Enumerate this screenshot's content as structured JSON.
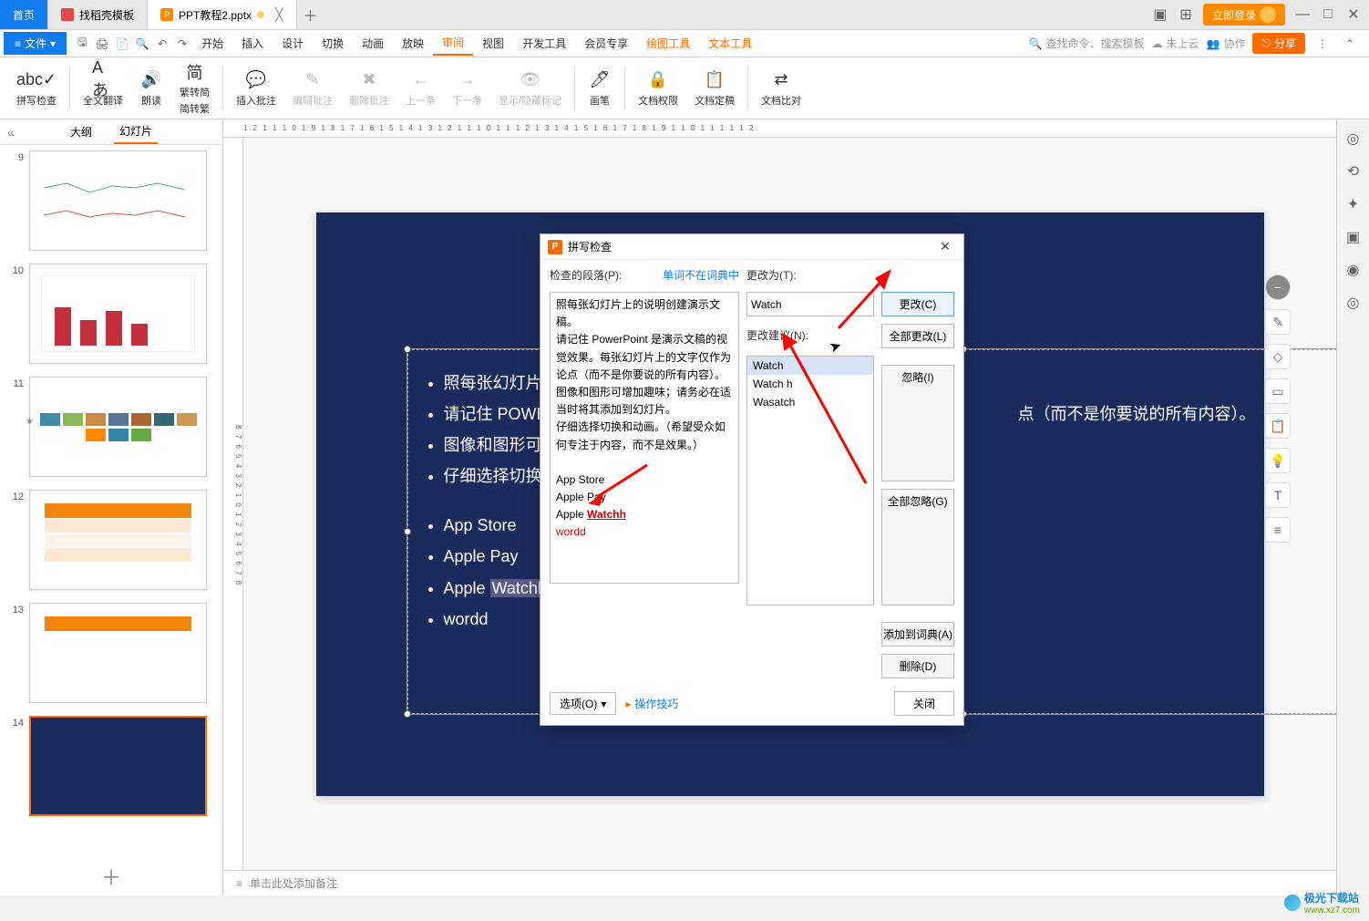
{
  "tabs": {
    "home": "首页",
    "template": "找稻壳模板",
    "doc": "PPT教程2.pptx"
  },
  "titlebarRight": {
    "login": "立即登录"
  },
  "fileMenu": "文件",
  "menu": {
    "start": "开始",
    "insert": "插入",
    "design": "设计",
    "transition": "切换",
    "anim": "动画",
    "show": "放映",
    "review": "审阅",
    "view": "视图",
    "dev": "开发工具",
    "member": "会员专享",
    "drawTool": "绘图工具",
    "textTool": "文本工具"
  },
  "menuRight": {
    "searchCmd": "查找命令、搜索模板",
    "cloud": "未上云",
    "coop": "协作",
    "share": "分享"
  },
  "ribbon": {
    "spell": "拼写检查",
    "translate": "全文翻译",
    "read": "朗读",
    "simpTrad": "繁转简",
    "simpTrad2": "简转繁",
    "insertComment": "插入批注",
    "editComment": "编辑批注",
    "deleteComment": "删除批注",
    "prev": "上一条",
    "next": "下一条",
    "showHide": "显示/隐藏标记",
    "ink": "画笔",
    "perm": "文档权限",
    "finalize": "文档定稿",
    "compare": "文档比对"
  },
  "panelTabs": {
    "outline": "大纲",
    "slides": "幻灯片"
  },
  "thumbNums": [
    "9",
    "10",
    "11",
    "12",
    "13",
    "14"
  ],
  "slideText": {
    "b1": "照每张幻灯片上的",
    "b2": "请记住 POWERP",
    "b2tail": "点（而不是你要说的所有内容）。",
    "b3": "图像和图形可增加",
    "b4": "仔细选择切换和动",
    "b5": "App Store",
    "b6": "Apple Pay",
    "b7a": "Apple ",
    "b7b": "Watchh",
    "b8": "wordd"
  },
  "dialog": {
    "title": "拼写检查",
    "paraLabel": "检查的段落(P):",
    "notInDict": "单词不在词典中",
    "changeToLabel": "更改为(T):",
    "changeToValue": "Watch",
    "suggestLabel": "更改建议(N):",
    "suggestions": [
      "Watch",
      "Watch h",
      "Wasatch"
    ],
    "para": {
      "l1": "照每张幻灯片上的说明创建演示文稿。",
      "l2": "请记住 PowerPoint 是演示文稿的视觉效果。每张幻灯片上的文字仅作为论点（而不是你要说的所有内容）。",
      "l3": "图像和图形可增加趣味；请务必在适当时将其添加到幻灯片。",
      "l4": "仔细选择切换和动画。（希望受众如何专注于内容，而不是效果。）",
      "l5": "App Store",
      "l6": "Apple Pay",
      "l7a": "Apple ",
      "l7b": "Watchh",
      "l8": "wordd"
    },
    "btnChange": "更改(C)",
    "btnChangeAll": "全部更改(L)",
    "btnIgnore": "忽略(I)",
    "btnIgnoreAll": "全部忽略(G)",
    "btnAddDict": "添加到词典(A)",
    "btnDelete": "删除(D)",
    "options": "选项(O)",
    "tips": "操作技巧",
    "close": "关闭"
  },
  "notes": "单击此处添加备注",
  "watermark": {
    "site": "极光下载站",
    "url": "www.xz7.com"
  }
}
